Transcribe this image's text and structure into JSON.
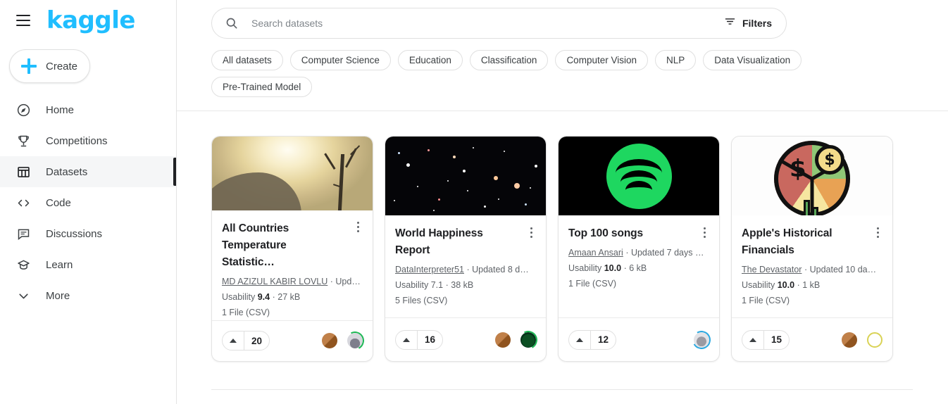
{
  "brand": {
    "logo_text": "kaggle",
    "logo_color": "#20beff"
  },
  "sidebar": {
    "menu_icon": "hamburger-icon",
    "create": {
      "label": "Create",
      "icon": "plus-icon"
    },
    "items": [
      {
        "label": "Home",
        "icon": "compass-icon",
        "active": false
      },
      {
        "label": "Competitions",
        "icon": "trophy-icon",
        "active": false
      },
      {
        "label": "Datasets",
        "icon": "table-icon",
        "active": true
      },
      {
        "label": "Code",
        "icon": "code-brackets-icon",
        "active": false
      },
      {
        "label": "Discussions",
        "icon": "comment-icon",
        "active": false
      },
      {
        "label": "Learn",
        "icon": "graduation-cap-icon",
        "active": false
      },
      {
        "label": "More",
        "icon": "chevron-down-icon",
        "active": false
      }
    ]
  },
  "search": {
    "placeholder": "Search datasets",
    "value": "",
    "icon": "search-icon",
    "filters_label": "Filters",
    "filters_icon": "filter-icon"
  },
  "chips": [
    "All datasets",
    "Computer Science",
    "Education",
    "Classification",
    "Computer Vision",
    "NLP",
    "Data Visualization",
    "Pre-Trained Model"
  ],
  "cards": [
    {
      "title": "All Countries Temperature Statistic…",
      "author": "MD AZIZUL KABIR LOVLU",
      "updated": "· Upd…",
      "usability_label": "Usability",
      "usability_value": "9.4",
      "size": "· 27 kB",
      "files": "1 File (CSV)",
      "votes": "20",
      "thumb": "sunset-tree-image",
      "avatars": [
        "brown-avatar",
        "person-green-ring-avatar"
      ]
    },
    {
      "title": "World Happiness Report",
      "author": "DataInterpreter51",
      "updated": "· Updated 8 d…",
      "usability_label": "Usability",
      "usability_value": "7.1",
      "usability_bold": false,
      "size": "· 38 kB",
      "files": "5 Files (CSV)",
      "votes": "16",
      "thumb": "deep-space-image",
      "avatars": [
        "brown-avatar",
        "dark-green-ring-avatar"
      ]
    },
    {
      "title": "Top 100 songs",
      "author": "Amaan Ansari",
      "updated": "· Updated 7 days …",
      "usability_label": "Usability",
      "usability_value": "10.0",
      "size": "· 6 kB",
      "files": "1 File (CSV)",
      "votes": "12",
      "thumb": "spotify-logo-image",
      "avatars": [
        "gray-blue-ring-avatar"
      ]
    },
    {
      "title": "Apple's Historical Financials",
      "author": "The Devastator",
      "updated": "· Updated 10 da…",
      "usability_label": "Usability",
      "usability_value": "10.0",
      "size": "· 1 kB",
      "files": "1 File (CSV)",
      "votes": "15",
      "thumb": "finance-pie-chart-image",
      "avatars": [
        "brown-avatar",
        "yellow-ring-avatar"
      ]
    }
  ]
}
